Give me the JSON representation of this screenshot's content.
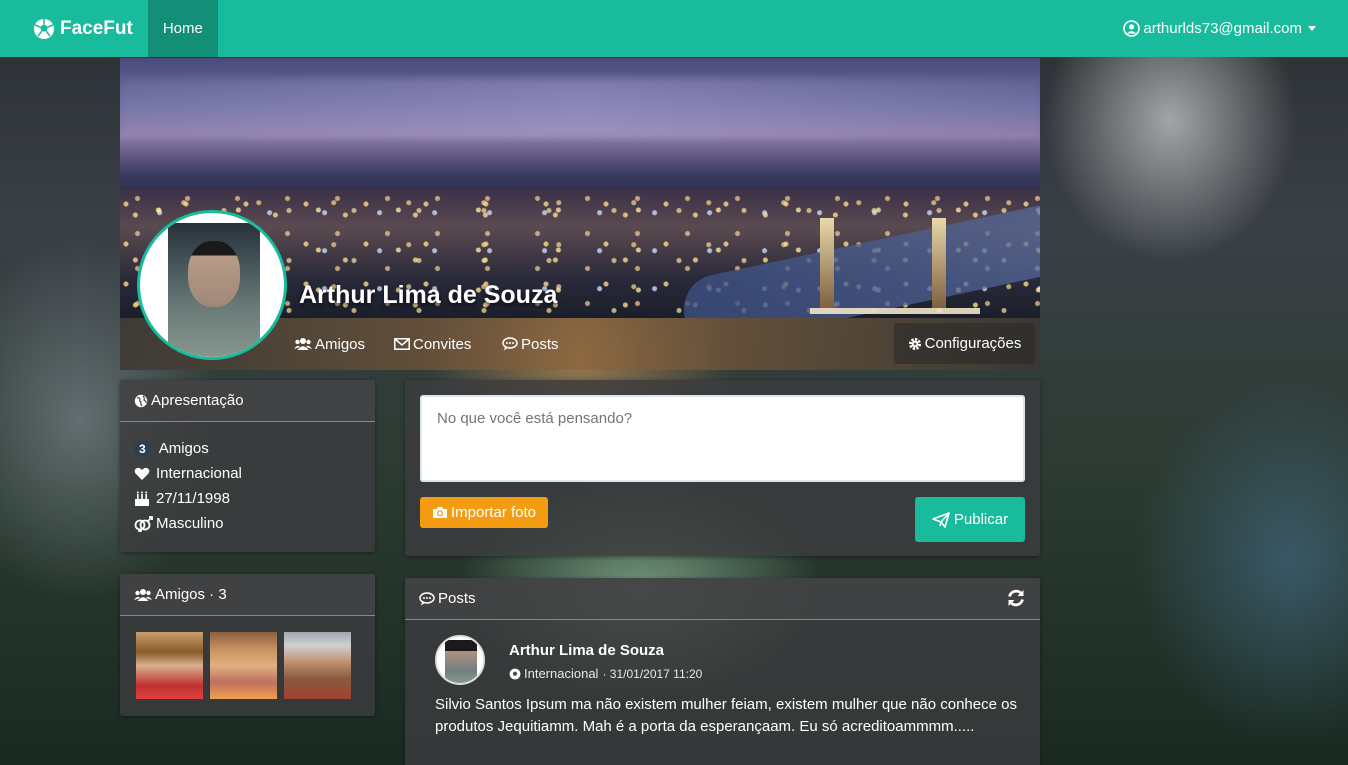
{
  "navbar": {
    "brand": "FaceFut",
    "home_label": "Home",
    "user_email": "arthurlds73@gmail.com"
  },
  "profile": {
    "name": "Arthur Lima de Souza",
    "nav": {
      "friends_label": "Amigos",
      "invites_label": "Convites",
      "posts_label": "Posts",
      "settings_label": "Configurações"
    }
  },
  "presentation": {
    "title": "Apresentação",
    "friends_count": "3",
    "friends_label": "Amigos",
    "team": "Internacional",
    "birthday": "27/11/1998",
    "gender": "Masculino"
  },
  "friends_panel": {
    "title": "Amigos · 3"
  },
  "composer": {
    "placeholder": "No que você está pensando?",
    "import_label": "Importar foto",
    "publish_label": "Publicar"
  },
  "posts": {
    "title": "Posts",
    "items": [
      {
        "author": "Arthur Lima de Souza",
        "team": "Internacional",
        "date": "· 31/01/2017 11:20",
        "body": "Silvio Santos Ipsum ma não existem mulher feiam, existem mulher que não conhece os produtos Jequitiamm. Mah é a porta da esperançaam. Eu só acreditoammmm....."
      }
    ]
  },
  "colors": {
    "primary": "#18bc9c",
    "primary_dark": "#128f76",
    "warning": "#f39c12",
    "badge": "#2c3e50"
  }
}
